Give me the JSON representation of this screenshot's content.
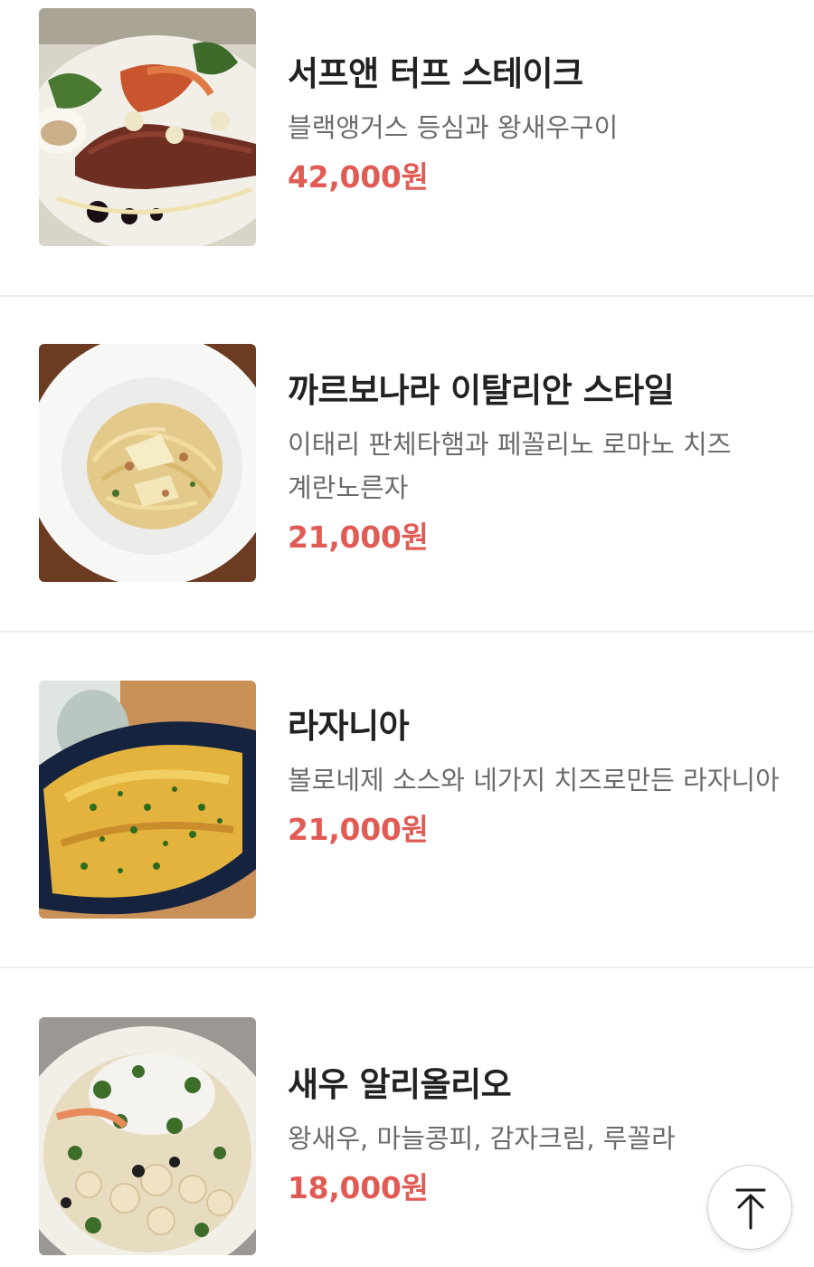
{
  "menu_items": [
    {
      "name": "서프앤 터프 스테이크",
      "description": "블랙앵거스 등심과 왕새우구이",
      "price": "42,000원",
      "image_icon": "steak-dish-photo"
    },
    {
      "name": "까르보나라 이탈리안 스타일",
      "description": "이태리 판체타햄과 페꼴리노 로마노 치즈 계란노른자",
      "price": "21,000원",
      "image_icon": "carbonara-pasta-photo"
    },
    {
      "name": "라자니아",
      "description": "볼로네제 소스와 네가지 치즈로만든 라자니아",
      "price": "21,000원",
      "image_icon": "lasagna-dish-photo"
    },
    {
      "name": "새우 알리올리오",
      "description": "왕새우, 마늘콩피, 감자크림, 루꼴라",
      "price": "18,000원",
      "image_icon": "shrimp-aglio-olio-photo"
    }
  ],
  "scroll_top_button": {
    "icon": "arrow-up-icon"
  },
  "colors": {
    "price": "#e15b55",
    "name": "#222222",
    "description": "#6b6b6b",
    "divider": "#ececec"
  }
}
